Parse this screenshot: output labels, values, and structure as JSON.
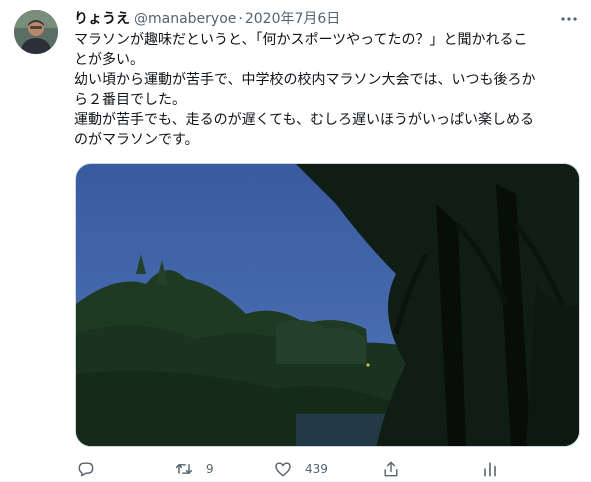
{
  "tweet": {
    "author_name": "りょうえ",
    "handle": "@manaberyoe",
    "separator": "·",
    "date": "2020年7月6日",
    "lines": [
      "マラソンが趣味だというと、「何かスポーツやってたの？」と聞かれるこ",
      "とが多い。",
      "幼い頃から運動が苦手で、中学校の校内マラソン大会では、いつも後ろか",
      "ら２番目でした。",
      "運動が苦手でも、走るのが遅くても、むしろ遅いほうがいっぱい楽しめる",
      "のがマラソンです。"
    ],
    "media_icon": "photo-dusk-trees",
    "actions": {
      "reply_icon": "reply-icon",
      "retweet_icon": "retweet-icon",
      "retweet_count": "9",
      "like_icon": "like-icon",
      "like_count": "439",
      "share_icon": "share-icon",
      "analytics_icon": "analytics-icon"
    },
    "colors": {
      "text": "#0f1419",
      "secondary": "#536471",
      "sky": "#3d5f9e"
    }
  }
}
